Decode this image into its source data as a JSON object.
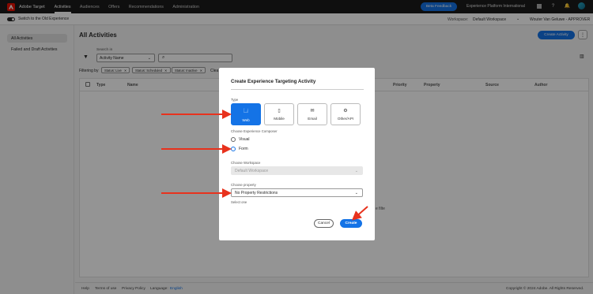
{
  "header": {
    "app_name": "Adobe Target",
    "nav": [
      "Activities",
      "Audiences",
      "Offers",
      "Recommendations",
      "Administration"
    ],
    "active_nav": "Activities",
    "beta_feedback": "Beta Feedback",
    "org_name": "Experience Platform International",
    "icons": [
      "apps-grid-icon",
      "help-icon",
      "bell-icon",
      "avatar"
    ]
  },
  "subbar": {
    "switch_label": "Switch to the Old Experience",
    "workspace_label": "Workspace:",
    "workspace_value": "Default Workspace",
    "user": "Wouter Van Geluwe - APPROVER"
  },
  "sidebar": {
    "items": [
      {
        "label": "All Activities",
        "selected": true
      },
      {
        "label": "Failed and Draft Activities",
        "selected": false
      }
    ]
  },
  "main": {
    "title": "All Activities",
    "create_button": "Create Activity",
    "search_in_label": "Search in",
    "search_in_value": "Activity Name",
    "filtering_by": "Filtering by",
    "chips": [
      "Status: Live",
      "Status: Scheduled",
      "Status: Inactive"
    ],
    "clear_label": "Clea",
    "columns": [
      "Type",
      "Name",
      "Priority",
      "Property",
      "Source",
      "Author"
    ],
    "empty_fragment": "e filte"
  },
  "footer": {
    "links": [
      "Help",
      "Terms of use",
      "Privacy Policy"
    ],
    "language_label": "Language:",
    "language_value": "English",
    "copyright": "Copyright © 2024 Adobe. All Rights Reserved."
  },
  "dialog": {
    "title": "Create Experience Targeting Activity",
    "type_label": "Type",
    "types": [
      {
        "label": "Web",
        "icon": "browser-icon",
        "selected": true
      },
      {
        "label": "Mobile",
        "icon": "mobile-icon",
        "selected": false
      },
      {
        "label": "Email",
        "icon": "email-icon",
        "selected": false
      },
      {
        "label": "Other/API",
        "icon": "api-icon",
        "selected": false
      }
    ],
    "composer_label": "Choose Experience Composer",
    "composer_options": [
      {
        "label": "Visual",
        "selected": false
      },
      {
        "label": "Form",
        "selected": true
      }
    ],
    "workspace_label": "Choose Workspace",
    "workspace_value": "Default Workspace",
    "property_label": "Choose property",
    "property_value": "No Property Restrictions",
    "property_helper": "Select one",
    "cancel": "Cancel",
    "create": "Create"
  },
  "colors": {
    "accent": "#1473e6",
    "arrow": "#e8321d",
    "topbar": "#1b1b1b"
  }
}
